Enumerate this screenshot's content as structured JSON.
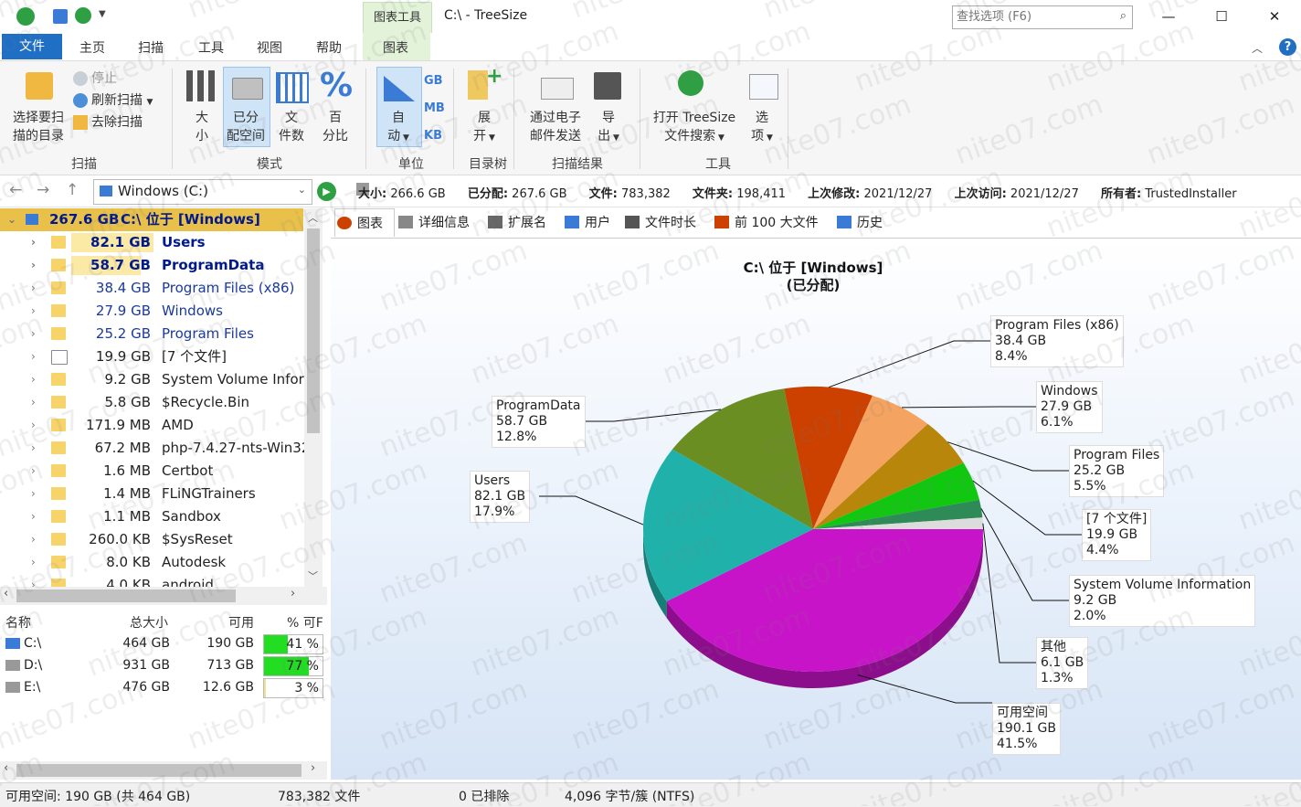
{
  "window": {
    "title": "C:\\ - TreeSize",
    "context_tab": "图表工具",
    "search_placeholder": "查找选项 (F6)"
  },
  "ribbon_tabs": [
    "文件",
    "主页",
    "扫描",
    "工具",
    "视图",
    "帮助",
    "图表"
  ],
  "ribbon": {
    "scan_group": {
      "select_dir": [
        "选择要扫",
        "描的目录"
      ],
      "stop": "停止",
      "refresh": "刷新扫描",
      "remove": "去除扫描",
      "label": "扫描"
    },
    "mode_group": {
      "size": [
        "大",
        "小"
      ],
      "allocated": [
        "已分",
        "配空间"
      ],
      "file_count": [
        "文",
        "件数"
      ],
      "percent": [
        "百",
        "分比"
      ],
      "label": "模式"
    },
    "unit_group": {
      "auto": [
        "自",
        "动"
      ],
      "gb": "GB",
      "mb": "MB",
      "kb": "KB",
      "label": "单位"
    },
    "tree_group": {
      "expand": [
        "展",
        "开"
      ],
      "label": "目录树"
    },
    "results_group": {
      "email": [
        "通过电子",
        "邮件发送"
      ],
      "export": [
        "导",
        "出"
      ],
      "label": "扫描结果"
    },
    "tools_group": {
      "open_search": [
        "打开 TreeSize",
        "文件搜索"
      ],
      "options": [
        "选",
        "项"
      ],
      "label": "工具"
    }
  },
  "address": {
    "drive": "Windows (C:)",
    "info": [
      {
        "k": "大小:",
        "v": "266.6 GB"
      },
      {
        "k": "已分配:",
        "v": "267.6 GB"
      },
      {
        "k": "文件:",
        "v": "783,382"
      },
      {
        "k": "文件夹:",
        "v": "198,411"
      },
      {
        "k": "上次修改:",
        "v": "2021/12/27"
      },
      {
        "k": "上次访问:",
        "v": "2021/12/27"
      },
      {
        "k": "所有者:",
        "v": "TrustedInstaller"
      }
    ]
  },
  "tree": {
    "root": {
      "size": "267.6 GB",
      "name": "C:\\  位于  [Windows]"
    },
    "items": [
      {
        "size": "82.1 GB",
        "name": "Users",
        "bold": true
      },
      {
        "size": "58.7 GB",
        "name": "ProgramData",
        "bold": true
      },
      {
        "size": "38.4 GB",
        "name": "Program Files (x86)"
      },
      {
        "size": "27.9 GB",
        "name": "Windows"
      },
      {
        "size": "25.2 GB",
        "name": "Program Files"
      },
      {
        "size": "19.9 GB",
        "name": "[7 个文件]"
      },
      {
        "size": "9.2 GB",
        "name": "System Volume Inforr"
      },
      {
        "size": "5.8 GB",
        "name": "$Recycle.Bin"
      },
      {
        "size": "171.9 MB",
        "name": "AMD"
      },
      {
        "size": "67.2 MB",
        "name": "php-7.4.27-nts-Win32"
      },
      {
        "size": "1.6 MB",
        "name": "Certbot"
      },
      {
        "size": "1.4 MB",
        "name": "FLiNGTrainers"
      },
      {
        "size": "1.1 MB",
        "name": "Sandbox"
      },
      {
        "size": "260.0 KB",
        "name": "$SysReset"
      },
      {
        "size": "8.0 KB",
        "name": "Autodesk"
      },
      {
        "size": "4.0 KB",
        "name": "android"
      }
    ]
  },
  "drives": {
    "headers": [
      "名称",
      "总大小",
      "可用",
      "% 可F"
    ],
    "rows": [
      {
        "name": "C:\\",
        "total": "464 GB",
        "free": "190 GB",
        "pct": "41 %",
        "pct_value": 41
      },
      {
        "name": "D:\\",
        "total": "931 GB",
        "free": "713 GB",
        "pct": "77 %",
        "pct_value": 77
      },
      {
        "name": "E:\\",
        "total": "476 GB",
        "free": "12.6 GB",
        "pct": "3 %",
        "pct_value": 3
      }
    ]
  },
  "view_tabs": [
    "图表",
    "详细信息",
    "扩展名",
    "用户",
    "文件时长",
    "前 100 大文件",
    "历史"
  ],
  "view_tab_icons": [
    "pie-icon",
    "details-icon",
    "extensions-icon",
    "users-icon",
    "calendar-icon",
    "top100-icon",
    "history-icon"
  ],
  "chart_data": {
    "type": "pie",
    "title": "C:\\  位于  [Windows]",
    "subtitle": "(已分配)",
    "slices": [
      {
        "name": "可用空间",
        "size": "190.1 GB",
        "pct_label": "41.5%",
        "value": 41.5,
        "color": "#c814c8"
      },
      {
        "name": "Users",
        "size": "82.1 GB",
        "pct_label": "17.9%",
        "value": 17.9,
        "color": "#20b2aa"
      },
      {
        "name": "ProgramData",
        "size": "58.7 GB",
        "pct_label": "12.8%",
        "value": 12.8,
        "color": "#6b8e23"
      },
      {
        "name": "Program Files (x86)",
        "size": "38.4 GB",
        "pct_label": "8.4%",
        "value": 8.4,
        "color": "#cc4000"
      },
      {
        "name": "Windows",
        "size": "27.9 GB",
        "pct_label": "6.1%",
        "value": 6.1,
        "color": "#f4a460"
      },
      {
        "name": "Program Files",
        "size": "25.2 GB",
        "pct_label": "5.5%",
        "value": 5.5,
        "color": "#b8860b"
      },
      {
        "name": "[7 个文件]",
        "size": "19.9 GB",
        "pct_label": "4.4%",
        "value": 4.4,
        "color": "#10c810"
      },
      {
        "name": "System Volume Information",
        "size": "9.2 GB",
        "pct_label": "2.0%",
        "value": 2.0,
        "color": "#2e8b57"
      },
      {
        "name": "其他",
        "size": "6.1 GB",
        "pct_label": "1.3%",
        "value": 1.3,
        "color": "#dcdcdc"
      }
    ]
  },
  "status": {
    "free": "可用空间: 190 GB (共 464 GB)",
    "files": "783,382 文件",
    "excluded": "0 已排除",
    "cluster": "4,096 字节/簇 (NTFS)"
  },
  "watermark": "nite07.com"
}
